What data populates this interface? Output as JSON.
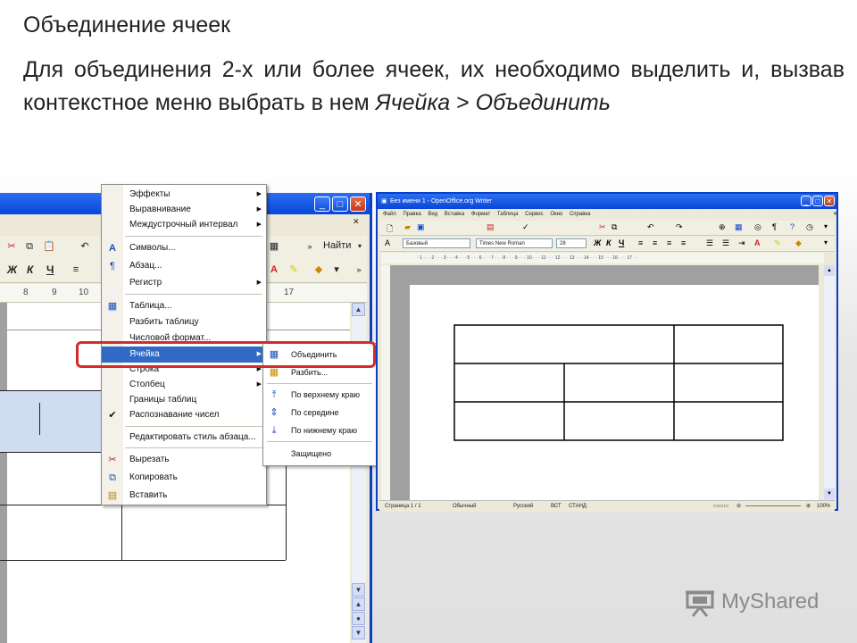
{
  "slide": {
    "title": "Объединение ячеек",
    "body_line1": "Для объединения 2-х или более ячеек, их необходимо выделить и, вызвав контекстное меню выбрать в нем",
    "body_cell_word": "Ячейка",
    "body_gt": " > ",
    "body_merge_word": "Объединить"
  },
  "left_window": {
    "find_button": "Найти",
    "bold": "Ж",
    "italic": "К",
    "underline": "Ч",
    "ruler_ticks": [
      "8",
      "9",
      "10",
      "17"
    ]
  },
  "context_menu": {
    "items": [
      {
        "label": "Эффекты",
        "submenu": true
      },
      {
        "label": "Выравнивание",
        "submenu": true
      },
      {
        "label": "Междустрочный интервал",
        "submenu": true
      },
      {
        "label": "Символы...",
        "submenu": false
      },
      {
        "label": "Абзац...",
        "submenu": false
      },
      {
        "label": "Регистр",
        "submenu": true
      },
      {
        "label": "Таблица...",
        "submenu": false
      },
      {
        "label": "Разбить таблицу",
        "submenu": false
      },
      {
        "label": "Числовой формат...",
        "submenu": false
      },
      {
        "label": "Ячейка",
        "submenu": true
      },
      {
        "label": "Строка",
        "submenu": true
      },
      {
        "label": "Столбец",
        "submenu": true
      },
      {
        "label": "Границы таблиц",
        "submenu": false
      },
      {
        "label": "Распознавание чисел",
        "submenu": false
      },
      {
        "label": "Редактировать стиль абзаца...",
        "submenu": false
      },
      {
        "label": "Вырезать",
        "submenu": false
      },
      {
        "label": "Копировать",
        "submenu": false
      },
      {
        "label": "Вставить",
        "submenu": false
      }
    ]
  },
  "cell_submenu": {
    "items": [
      {
        "label": "Объединить"
      },
      {
        "label": "Разбить..."
      },
      {
        "label": "По верхнему краю"
      },
      {
        "label": "По середине"
      },
      {
        "label": "По нижнему краю"
      },
      {
        "label": "Защищено"
      }
    ]
  },
  "right_window": {
    "title": "Без имени 1 - OpenOffice.org Writer",
    "menu": [
      "Файл",
      "Правка",
      "Вид",
      "Вставка",
      "Формат",
      "Таблица",
      "Сервис",
      "Окно",
      "Справка"
    ],
    "style_combo": "Базовый",
    "font_combo": "Times New Roman",
    "size_combo": "28",
    "status": {
      "page": "Страница 1 / 1",
      "style": "Обычный",
      "language": "Русский",
      "insert_mode": "ВСТ",
      "selection_mode": "СТАНД",
      "zoom": "100%"
    }
  },
  "watermark": {
    "text": "MyShared"
  },
  "colors": {
    "highlight": "#316ac5",
    "red_box": "#d42a2a",
    "titlebar": "#0846d8"
  }
}
